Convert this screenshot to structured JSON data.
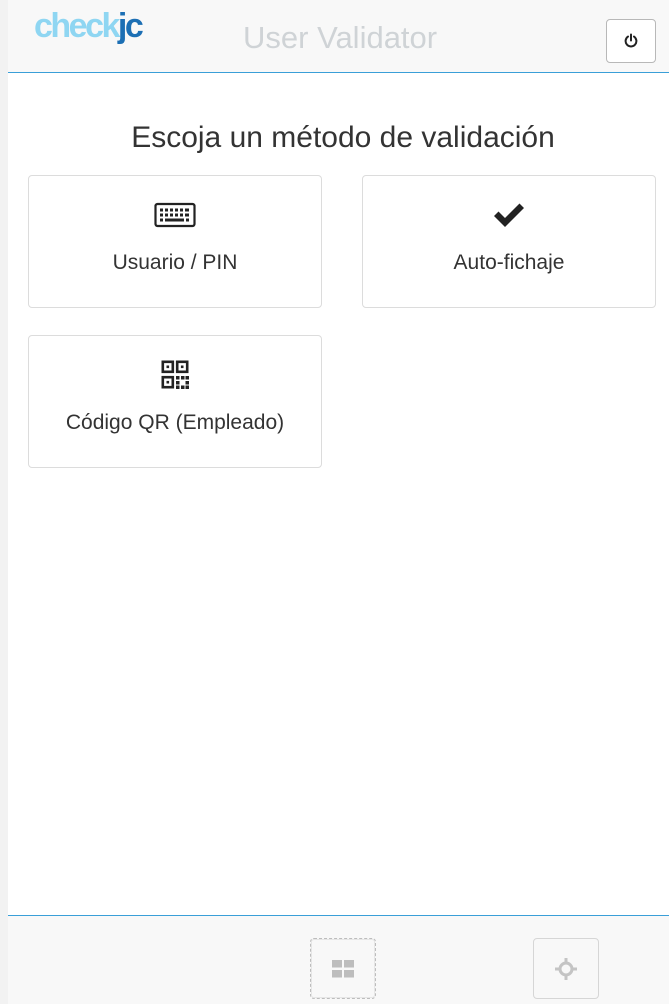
{
  "header": {
    "logo_part1": "check",
    "logo_part2": "jc",
    "title": "User Validator",
    "power_icon": "power-icon"
  },
  "main": {
    "heading": "Escoja un método de validación",
    "methods": [
      {
        "label": "Usuario / PIN",
        "icon": "keyboard-icon"
      },
      {
        "label": "Auto-fichaje",
        "icon": "check-icon"
      },
      {
        "label": "Código QR (Empleado)",
        "icon": "qrcode-icon"
      }
    ]
  },
  "footer": {
    "buttons": [
      {
        "icon": "grid-icon"
      },
      {
        "icon": "crosshair-icon"
      }
    ]
  },
  "colors": {
    "accent": "#3a9fd8",
    "logo_light": "#8fd6f2",
    "logo_dark": "#1c6fb4",
    "title_gray": "#cfd3d6"
  }
}
